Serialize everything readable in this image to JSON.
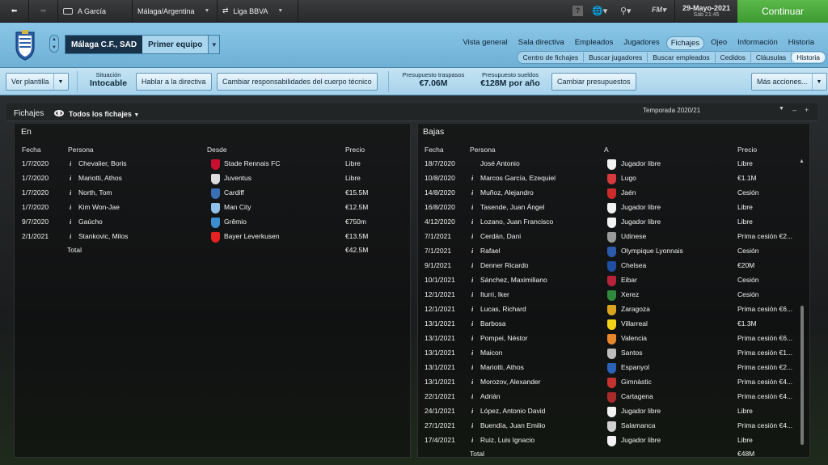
{
  "topbar": {
    "breadcrumbs": [
      "A García",
      "Málaga/Argentina",
      "Liga BBVA"
    ],
    "date": "29-Mayo-2021",
    "time": "Sáb 21:45",
    "fm_label": "FM",
    "continue_label": "Continuar"
  },
  "header": {
    "club_name": "Málaga C.F., SAD",
    "squad_name": "Primer equipo",
    "nav": [
      "Vista general",
      "Sala directiva",
      "Empleados",
      "Jugadores",
      "Fichajes",
      "Ojeo",
      "Información",
      "Historia"
    ],
    "active_nav": "Fichajes",
    "subnav": [
      "Centro de fichajes",
      "Buscar jugadores",
      "Buscar empleados",
      "Cedidos",
      "Cláusulas",
      "Historia"
    ],
    "active_subnav": "Historia"
  },
  "actionbar": {
    "ver_plantilla": "Ver plantilla",
    "situacion_label": "Situación",
    "situacion_value": "Intocable",
    "hablar": "Hablar a la directiva",
    "cambiar_resp": "Cambiar responsabilidades del cuerpo técnico",
    "presupuesto_traspasos_label": "Presupuesto traspasos",
    "presupuesto_traspasos_value": "€7.06M",
    "presupuesto_sueldos_label": "Presupuesto sueldos",
    "presupuesto_sueldos_value": "€128M por año",
    "cambiar_presupuestos": "Cambiar presupuestos",
    "mas_acciones": "Más acciones..."
  },
  "panel": {
    "title": "Fichajes",
    "filter": "Todos los fichajes",
    "season": "Temporada 2020/21"
  },
  "en": {
    "title": "En",
    "headers": [
      "Fecha",
      "Persona",
      "Desde",
      "Precio"
    ],
    "rows": [
      {
        "fecha": "1/7/2020",
        "persona": "Chevalier, Boris",
        "club": "Stade Rennais FC",
        "precio": "Libre",
        "color": "#c8102e"
      },
      {
        "fecha": "1/7/2020",
        "persona": "Mariotti, Athos",
        "club": "Juventus",
        "precio": "Libre",
        "color": "#dddddd"
      },
      {
        "fecha": "1/7/2020",
        "persona": "North, Tom",
        "club": "Cardiff",
        "precio": "€15.5M",
        "color": "#3a6fb5"
      },
      {
        "fecha": "1/7/2020",
        "persona": "Kim Won-Jae",
        "club": "Man City",
        "precio": "€12.5M",
        "color": "#8fc2e6"
      },
      {
        "fecha": "9/7/2020",
        "persona": "Gaúcho",
        "club": "Grêmio",
        "precio": "€750m",
        "color": "#3b8fd1"
      },
      {
        "fecha": "2/1/2021",
        "persona": "Stankovic, Milos",
        "club": "Bayer Leverkusen",
        "precio": "€13.5M",
        "color": "#e32221"
      }
    ],
    "total_label": "Total",
    "total_value": "€42.5M"
  },
  "bajas": {
    "title": "Bajas",
    "headers": [
      "Fecha",
      "Persona",
      "A",
      "Precio"
    ],
    "rows": [
      {
        "fecha": "18/7/2020",
        "persona": "José Antonio",
        "info": false,
        "club": "Jugador libre",
        "precio": "Libre",
        "color": "#f2f2f2"
      },
      {
        "fecha": "10/8/2020",
        "persona": "Marcos García, Ezequiel",
        "info": true,
        "club": "Lugo",
        "precio": "€1.1M",
        "color": "#d63a3a"
      },
      {
        "fecha": "14/8/2020",
        "persona": "Muñoz, Alejandro",
        "info": true,
        "club": "Jaén",
        "precio": "Cesión",
        "color": "#cc2b2b"
      },
      {
        "fecha": "16/8/2020",
        "persona": "Tasende, Juan Ángel",
        "info": true,
        "club": "Jugador libre",
        "precio": "Libre",
        "color": "#f2f2f2"
      },
      {
        "fecha": "4/12/2020",
        "persona": "Lozano, Juan Francisco",
        "info": true,
        "club": "Jugador libre",
        "precio": "Libre",
        "color": "#f2f2f2"
      },
      {
        "fecha": "7/1/2021",
        "persona": "Cerdán, Dani",
        "info": true,
        "club": "Udinese",
        "precio": "Prima cesión €2...",
        "color": "#9a9a9a"
      },
      {
        "fecha": "7/1/2021",
        "persona": "Rafael",
        "info": true,
        "club": "Olympique Lyonnais",
        "precio": "Cesión",
        "color": "#2a5aa8"
      },
      {
        "fecha": "9/1/2021",
        "persona": "Denner Ricardo",
        "info": true,
        "club": "Chelsea",
        "precio": "€20M",
        "color": "#1e4fa3"
      },
      {
        "fecha": "10/1/2021",
        "persona": "Sánchez, Maximiliano",
        "info": true,
        "club": "Eibar",
        "precio": "Cesión",
        "color": "#b5223a"
      },
      {
        "fecha": "12/1/2021",
        "persona": "Iturri, Iker",
        "info": true,
        "club": "Xerez",
        "precio": "Cesión",
        "color": "#2f8a3e"
      },
      {
        "fecha": "12/1/2021",
        "persona": "Lucas, Richard",
        "info": true,
        "club": "Zaragoza",
        "precio": "Prima cesión €6...",
        "color": "#d9a31f"
      },
      {
        "fecha": "13/1/2021",
        "persona": "Barbosa",
        "info": true,
        "club": "Villarreal",
        "precio": "€1.3M",
        "color": "#f0d21b"
      },
      {
        "fecha": "13/1/2021",
        "persona": "Pompei, Néstor",
        "info": true,
        "club": "Valencia",
        "precio": "Prima cesión €6...",
        "color": "#e8862a"
      },
      {
        "fecha": "13/1/2021",
        "persona": "Maicon",
        "info": true,
        "club": "Santos",
        "precio": "Prima cesión €1...",
        "color": "#bdbdbd"
      },
      {
        "fecha": "13/1/2021",
        "persona": "Mariotti, Athos",
        "info": true,
        "club": "Espanyol",
        "precio": "Prima cesión €2...",
        "color": "#2a62b8"
      },
      {
        "fecha": "13/1/2021",
        "persona": "Morozov, Alexander",
        "info": true,
        "club": "Gimnàstic",
        "precio": "Prima cesión €4...",
        "color": "#c43232"
      },
      {
        "fecha": "22/1/2021",
        "persona": "Adrián",
        "info": true,
        "club": "Cartagena",
        "precio": "Prima cesión €4...",
        "color": "#a82b2b"
      },
      {
        "fecha": "24/1/2021",
        "persona": "López, Antonio David",
        "info": true,
        "club": "Jugador libre",
        "precio": "Libre",
        "color": "#f2f2f2"
      },
      {
        "fecha": "27/1/2021",
        "persona": "Buendía, Juan Emilio",
        "info": true,
        "club": "Salamanca",
        "precio": "Prima cesión €4...",
        "color": "#d0d0d0"
      },
      {
        "fecha": "17/4/2021",
        "persona": "Ruiz, Luis Ignacio",
        "info": true,
        "club": "Jugador libre",
        "precio": "Libre",
        "color": "#f2f2f2"
      }
    ],
    "total_label": "Total",
    "total_value": "€48M"
  }
}
